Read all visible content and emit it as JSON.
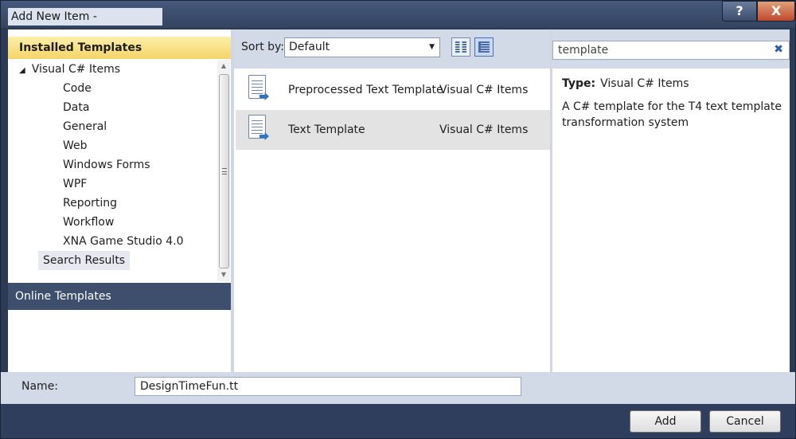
{
  "window": {
    "title": "Add New Item - Introduction",
    "help_glyph": "?",
    "close_glyph": "X"
  },
  "left": {
    "installed_header": "Installed Templates",
    "tree": {
      "root": "Visual C# Items",
      "children": [
        "Code",
        "Data",
        "General",
        "Web",
        "Windows Forms",
        "WPF",
        "Reporting",
        "Workflow",
        "XNA Game Studio 4.0"
      ],
      "search_results": "Search Results"
    },
    "online_templates": "Online Templates"
  },
  "toolbar": {
    "sort_label": "Sort by:",
    "sort_value": "Default"
  },
  "items": [
    {
      "name": "Preprocessed Text Template",
      "category": "Visual C# Items",
      "selected": false
    },
    {
      "name": "Text Template",
      "category": "Visual C# Items",
      "selected": true
    }
  ],
  "search": {
    "value": "template"
  },
  "details": {
    "type_label": "Type:",
    "type_value": "Visual C# Items",
    "description": "A C# template for the T4 text template transformation system"
  },
  "name_field": {
    "label": "Name:",
    "value": "DesignTimeFun.tt"
  },
  "buttons": {
    "add": "Add",
    "cancel": "Cancel"
  }
}
